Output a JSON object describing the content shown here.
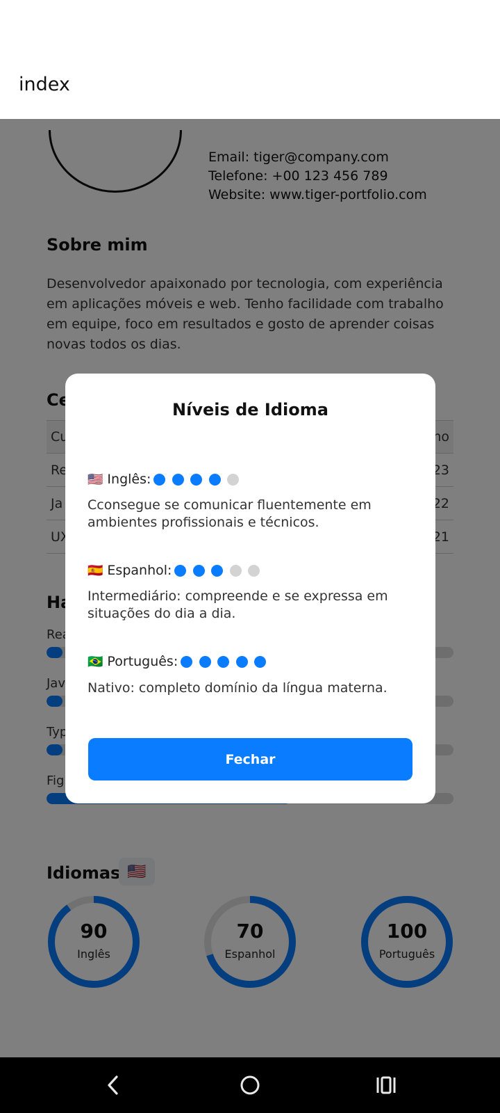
{
  "header": {
    "title": "index"
  },
  "contact": {
    "email": "Email: tiger@company.com",
    "phone": "Telefone: +00 123 456 789",
    "website": "Website: www.tiger-portfolio.com"
  },
  "about": {
    "title": "Sobre mim",
    "text": "Desenvolvedor apaixonado por tecnologia, com experiência em aplicações móveis e web. Tenho facilidade com trabalho em equipe, foco em resultados e gosto de aprender coisas novas todos os dias."
  },
  "certs": {
    "title_partial": "Ce",
    "rows": [
      {
        "left": "Cu",
        "right": "no"
      },
      {
        "left": "Re",
        "right": "23"
      },
      {
        "left": "Ja",
        "right": "22"
      },
      {
        "left": "UX",
        "right": "021"
      }
    ]
  },
  "skills": {
    "title_partial": "Ha",
    "items": [
      {
        "label": "Rea",
        "level": 0.04
      },
      {
        "label": "Jav",
        "level": 0.04
      },
      {
        "label": "Typ",
        "level": 0.04
      },
      {
        "label": "Fig",
        "level": 0.6
      }
    ]
  },
  "languages_section": {
    "title": "Idiomas",
    "flag": "🇺🇸",
    "rings": [
      {
        "value": "90",
        "label": "Inglês",
        "percent": 90
      },
      {
        "value": "70",
        "label": "Espanhol",
        "percent": 70
      },
      {
        "value": "100",
        "label": "Português",
        "percent": 100
      }
    ]
  },
  "modal": {
    "title": "Níveis de Idioma",
    "languages": [
      {
        "flag": "🇺🇸",
        "label": "Inglês:",
        "level": 4,
        "max": 5,
        "description": "Cconsegue se comunicar fluentemente em ambientes profissionais e técnicos."
      },
      {
        "flag": "🇪🇸",
        "label": "Espanhol:",
        "level": 3,
        "max": 5,
        "description": "Intermediário: compreende e se expressa em situações do dia a dia."
      },
      {
        "flag": "🇧🇷",
        "label": "Português:",
        "level": 5,
        "max": 5,
        "description": "Nativo: completo domínio da língua materna."
      }
    ],
    "close_label": "Fechar"
  },
  "colors": {
    "accent": "#0a7cff",
    "ring": "#0a7cff",
    "dot_off": "#d3d3d3"
  },
  "navbar": {
    "icons": [
      "back-icon",
      "home-icon",
      "recents-icon"
    ]
  }
}
